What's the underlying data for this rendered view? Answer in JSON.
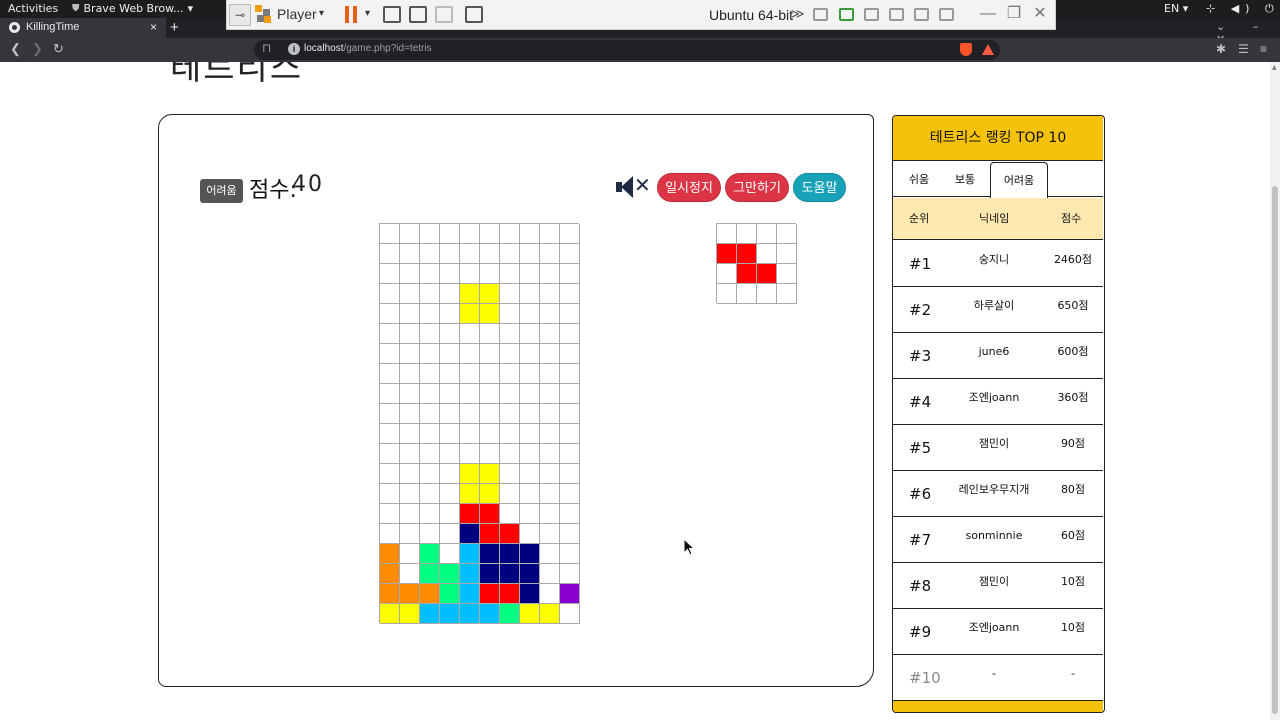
{
  "gnome": {
    "activities": "Activities",
    "app_name": "Brave Web Brow...",
    "lang": "EN",
    "lang_caret": "▾",
    "app_caret": "▾",
    "sys_icons": "⊹ ◀) ⏻ ▾"
  },
  "player": {
    "pin": "⊸",
    "label": "Player",
    "caret": "▾",
    "vm_name": "Ubuntu 64-bit",
    "more": "≫",
    "minimize": "—",
    "maximize": "❐",
    "close": "✕"
  },
  "browser": {
    "tab_title": "KillingTime",
    "tab_close": "×",
    "new_tab": "+",
    "win_controls": "⌄ – ✕",
    "back": "❮",
    "forward": "❯",
    "reload": "↻",
    "bookmark": "⊓",
    "info": "i",
    "url_host": "localhost",
    "url_path": "/game.php?id=tetris",
    "ext_puzzle": "✱",
    "ext_media": "☰",
    "ext_menu": "≡"
  },
  "page": {
    "title": "테트리스"
  },
  "game": {
    "difficulty_badge": "어려움",
    "score_label": "점수:",
    "score_value": "40",
    "sound_state": "muted",
    "mute_x": "✕",
    "buttons": {
      "pause": "일시정지",
      "quit": "그만하기",
      "help": "도움말"
    },
    "colors": {
      "Y": "#ffff00",
      "R": "#ff0000",
      "B": "#00007f",
      "O": "#ff8c00",
      "G": "#00ff7f",
      "C": "#00bfff",
      "P": "#8b00cc",
      "_": "#ffffff"
    },
    "board": [
      "..........",
      "..........",
      "..........",
      "..........",
      "..........",
      "..........",
      "..........",
      "..........",
      "..........",
      "..........",
      "..........",
      "..........",
      "..........",
      "..........",
      "..........",
      "..........",
      "..........",
      ".....YY...",
      "..........",
      "..........",
      "..........",
      "..........",
      "..........",
      "..........",
      "..........",
      "..........",
      "..........",
      "..........",
      "..........",
      "..........",
      "..........",
      "..........",
      "..........",
      "..........",
      "..........",
      "..........",
      "..........",
      "..........",
      "..........",
      ".........."
    ],
    "board_rows": [
      "..........",
      "..........",
      "..........",
      "....YY....",
      "....YY....",
      "..........",
      "..........",
      "..........",
      "..........",
      "..........",
      "..........",
      "..........",
      "....YY....",
      "....YY....",
      "....RR....",
      "....BRR...",
      "O.G.CBBB..",
      "O.GGCBBB..",
      "OOOGCRRB.P",
      "YYCCCCGYY_"
    ],
    "next_piece": [
      "....",
      "RR..",
      ".RR.",
      "...."
    ]
  },
  "ranking": {
    "title": "테트리스 랭킹 TOP 10",
    "tabs": [
      "쉬움",
      "보통",
      "어려움"
    ],
    "active_tab": "어려움",
    "headers": {
      "rank": "순위",
      "nickname": "닉네임",
      "score": "점수"
    },
    "rows": [
      {
        "rank": "#1",
        "nickname": "숭지니",
        "score": "2460점"
      },
      {
        "rank": "#2",
        "nickname": "하루살이",
        "score": "650점"
      },
      {
        "rank": "#3",
        "nickname": "june6",
        "score": "600점"
      },
      {
        "rank": "#4",
        "nickname": "조엔joann",
        "score": "360점"
      },
      {
        "rank": "#5",
        "nickname": "잼민이",
        "score": "90점"
      },
      {
        "rank": "#6",
        "nickname": "레인보우무지개",
        "score": "80점"
      },
      {
        "rank": "#7",
        "nickname": "sonminnie",
        "score": "60점"
      },
      {
        "rank": "#8",
        "nickname": "잼민이",
        "score": "10점"
      },
      {
        "rank": "#9",
        "nickname": "조엔joann",
        "score": "10점"
      },
      {
        "rank": "#10",
        "nickname": "-",
        "score": "-"
      }
    ]
  }
}
